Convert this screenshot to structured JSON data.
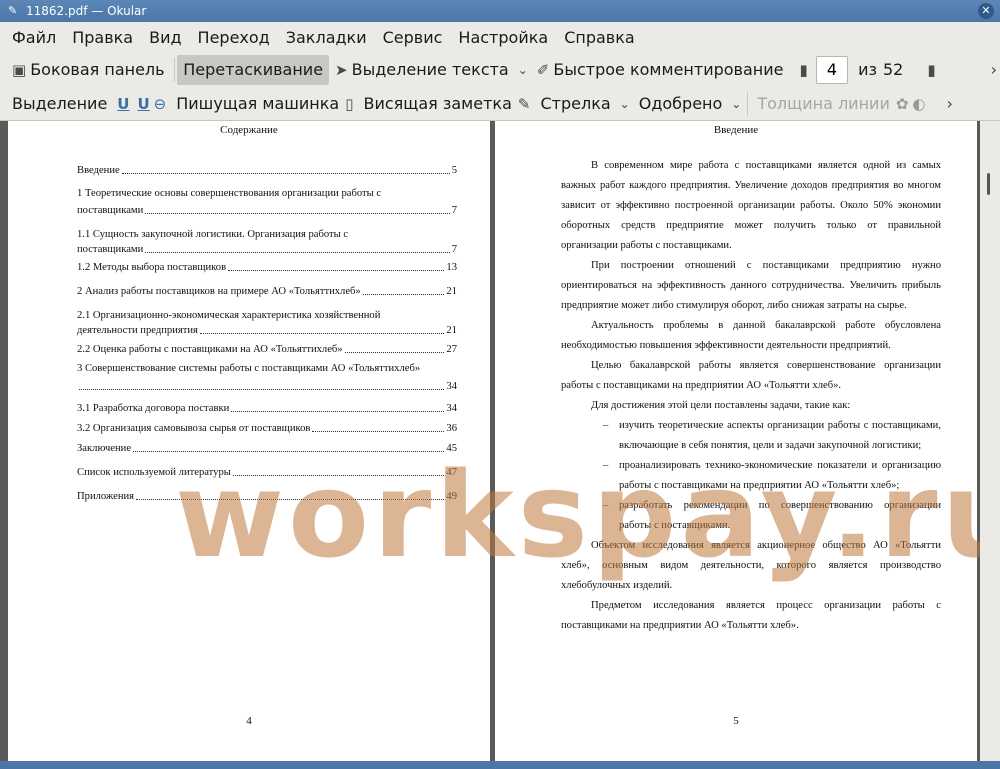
{
  "window": {
    "title": "11862.pdf — Okular"
  },
  "menu": [
    "Файл",
    "Правка",
    "Вид",
    "Переход",
    "Закладки",
    "Сервис",
    "Настройка",
    "Справка"
  ],
  "toolbar1": {
    "sidebar": "Боковая панель",
    "drag": "Перетаскивание",
    "text_select": "Выделение текста",
    "quick_comment": "Быстрое комментирование",
    "page_value": "4",
    "of_label": "из",
    "total_pages": "52"
  },
  "toolbar2": {
    "highlight": "Выделение",
    "typewriter": "Пишущая машинка",
    "sticky_note": "Висящая заметка",
    "arrow": "Стрелка",
    "approved": "Одобрено",
    "line_width": "Толщина линии"
  },
  "left_page": {
    "heading": "Содержание",
    "page_number": "4",
    "toc": [
      {
        "text": "Введение",
        "page": "5"
      },
      {
        "text": "1     Теоретические основы совершенствования организации работы с",
        "page": ""
      },
      {
        "text": "поставщиками",
        "page": "7"
      },
      {
        "text": "1.1       Сущность закупочной логистики. Организация работы с",
        "page": ""
      },
      {
        "text": "поставщиками",
        "page": "7"
      },
      {
        "text": "1.2 Методы выбора поставщиков",
        "page": "13"
      },
      {
        "text": "2 Анализ работы поставщиков на примере АО «Тольяттихлеб»",
        "page": "21"
      },
      {
        "text": "2.1 Организационно-экономическая характеристика хозяйственной",
        "page": ""
      },
      {
        "text": "деятельности предприятия",
        "page": "21"
      },
      {
        "text": "2.2 Оценка работы с поставщиками на АО «Тольяттихлеб»",
        "page": "27"
      },
      {
        "text": "3 Совершенствование системы работы с поставщиками АО «Тольяттихлеб»",
        "page": ""
      },
      {
        "text": "",
        "page": "34"
      },
      {
        "text": "3.1 Разработка договора поставки",
        "page": "34"
      },
      {
        "text": "3.2       Организация самовывоза сырья от поставщиков",
        "page": "36"
      },
      {
        "text": "Заключение",
        "page": "45"
      },
      {
        "text": "Список используемой литературы",
        "page": "47"
      },
      {
        "text": "Приложения",
        "page": "49"
      }
    ]
  },
  "right_page": {
    "heading": "Введение",
    "page_number": "5",
    "p1": "В современном мире работа с поставщиками является одной из самых важных работ каждого предприятия. Увеличение доходов предприятия во многом зависит от эффективно построенной организации работы. Около 50% экономии оборотных средств предприятие может получить только от правильной организации работы с поставщиками.",
    "p2": "При построении отношений с поставщиками предприятию нужно ориентироваться на эффективность данного сотрудничества. Увеличить прибыль предприятие может либо стимулируя оборот, либо снижая затраты на сырье.",
    "p3": "Актуальность проблемы в данной бакалаврской работе обусловлена необходимостью повышения эффективности деятельности предприятий.",
    "p4": "Целью бакалаврской работы является совершенствование организации работы с поставщиками на предприятии АО «Тольятти хлеб».",
    "p5": "Для достижения этой цели поставлены задачи, такие как:",
    "bullets": [
      "изучить теоретические аспекты организации работы с поставщиками, включающие в себя понятия, цели и задачи закупочной логистики;",
      "проанализировать технико-экономические показатели и организацию работы с поставщиками на предприятии АО «Тольятти хлеб»;",
      "разработать рекомендации по совершенствованию организации работы с поставщиками."
    ],
    "p6": "Объектом исследования является акционерное общество АО «Тольятти хлеб», основным видом деятельности, которого является производство хлебобулочных изделий.",
    "p7": "Предметом исследования является процесс организации работы с поставщиками на предприятии АО «Тольятти хлеб»."
  },
  "watermark": "workspay.ru"
}
